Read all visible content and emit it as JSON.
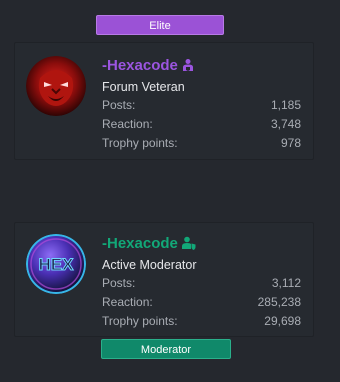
{
  "users": [
    {
      "banner": "Elite",
      "username": "-Hexacode",
      "user_title": "Forum Veteran",
      "badge_icon": "shield-user-icon",
      "stats": [
        {
          "label": "Posts:",
          "value": "1,185"
        },
        {
          "label": "Reaction:",
          "value": "3,748"
        },
        {
          "label": "Trophy points:",
          "value": "978"
        }
      ],
      "name_color": "#9b55e0"
    },
    {
      "banner": "Moderator",
      "username": "-Hexacode",
      "user_title": "Active Moderator",
      "badge_icon": "user-shield-icon",
      "stats": [
        {
          "label": "Posts:",
          "value": "3,112"
        },
        {
          "label": "Reaction:",
          "value": "285,238"
        },
        {
          "label": "Trophy points:",
          "value": "29,698"
        }
      ],
      "name_color": "#12a878"
    }
  ],
  "avatar_text": "HEX"
}
